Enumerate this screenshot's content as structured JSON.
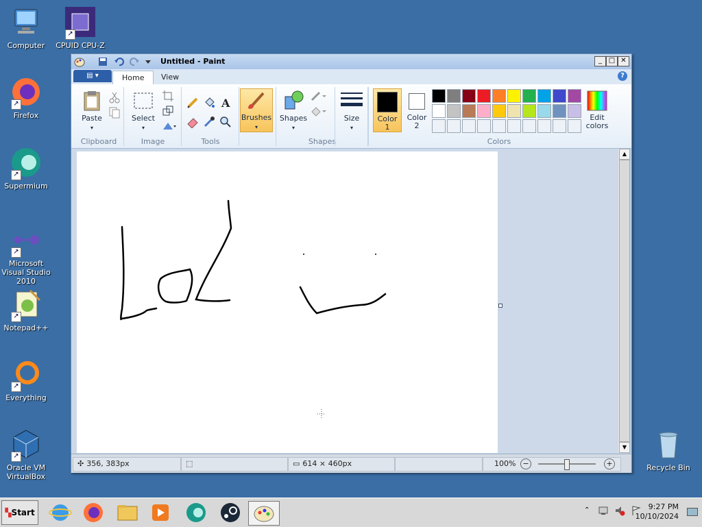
{
  "desktop": {
    "icons": [
      {
        "label": "Computer",
        "icon": "computer-icon"
      },
      {
        "label": "CPUID CPU-Z",
        "icon": "cpu-z-icon"
      },
      {
        "label": "Firefox",
        "icon": "firefox-icon"
      },
      {
        "label": "Supermium",
        "icon": "supermium-icon"
      },
      {
        "label": "Microsoft Visual Studio 2010",
        "icon": "visual-studio-icon"
      },
      {
        "label": "Notepad++",
        "icon": "notepad-plus-plus-icon"
      },
      {
        "label": "Everything",
        "icon": "everything-icon"
      },
      {
        "label": "Oracle VM VirtualBox",
        "icon": "virtualbox-icon"
      },
      {
        "label": "Recycle Bin",
        "icon": "recycle-bin-icon"
      }
    ]
  },
  "window": {
    "title": "Untitled - Paint",
    "tabs": [
      "Home",
      "View"
    ],
    "groups": {
      "clipboard": {
        "label": "Clipboard",
        "paste": "Paste"
      },
      "image": {
        "label": "Image",
        "select": "Select"
      },
      "tools": {
        "label": "Tools"
      },
      "brushes": {
        "label": "Brushes"
      },
      "shapes": {
        "label": "Shapes",
        "shapes_btn": "Shapes"
      },
      "size": {
        "label": "Size"
      },
      "colors": {
        "label": "Colors",
        "color1": "Color 1",
        "color2": "Color 2",
        "edit_colors": "Edit colors",
        "color1_value": "#000000",
        "color2_value": "#ffffff",
        "palette_row1": [
          "#000000",
          "#7f7f7f",
          "#880015",
          "#ed1c24",
          "#ff7f27",
          "#fff200",
          "#22b14c",
          "#00a2e8",
          "#3f48cc",
          "#a349a4"
        ],
        "palette_row2": [
          "#ffffff",
          "#c3c3c3",
          "#b97a57",
          "#ffaec9",
          "#ffc90e",
          "#efe4b0",
          "#b5e61d",
          "#99d9ea",
          "#7092be",
          "#c8bfe7"
        ]
      }
    },
    "status": {
      "cursor_pos": "356, 383px",
      "image_size": "614 × 460px",
      "zoom": "100%"
    }
  },
  "taskbar": {
    "start": "Start",
    "time": "9:27 PM",
    "date": "10/10/2024",
    "apps": [
      "internet-explorer-icon",
      "firefox-icon",
      "file-explorer-icon",
      "media-player-icon",
      "supermium-icon",
      "steam-icon",
      "paint-icon"
    ]
  }
}
